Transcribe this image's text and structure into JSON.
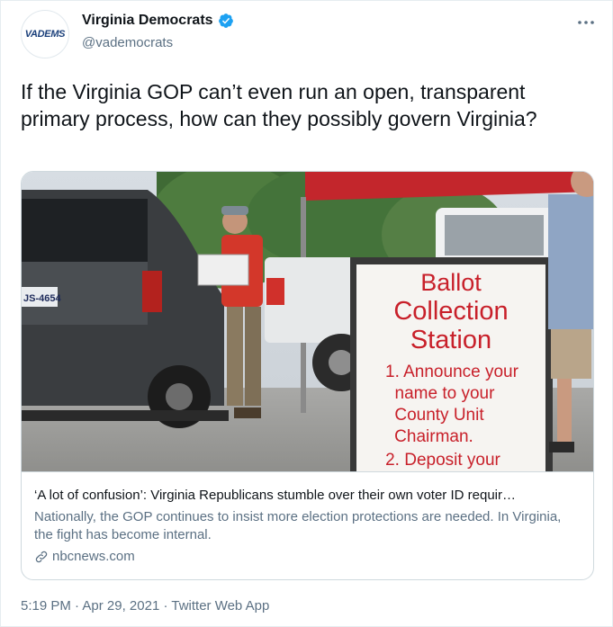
{
  "author": {
    "avatar_text_a": "VA",
    "avatar_text_b": "DEMS",
    "display_name": "Virginia Democrats",
    "handle": "@vademocrats",
    "verified": true,
    "verified_icon": "verified-badge-icon"
  },
  "menu": {
    "icon": "more-options-icon"
  },
  "tweet": {
    "text": "If the Virginia GOP can’t even run an open, transparent primary process, how can they possibly govern Virginia?"
  },
  "card": {
    "sign_lines": [
      "Ballot",
      "Collection",
      "Station",
      "1. Announce your",
      "name to your",
      "County Unit",
      "Chairman.",
      "2. Deposit your"
    ],
    "plate_text": "JS-4654",
    "title": "‘A lot of confusion’: Virginia Republicans stumble over their own voter ID requir…",
    "description": "Nationally, the GOP continues to insist more election protections are needed. In Virginia, the fight has become internal.",
    "domain": "nbcnews.com",
    "link_icon": "link-icon"
  },
  "footer": {
    "time": "5:19 PM",
    "sep1": " · ",
    "date": "Apr 29, 2021",
    "sep2": " · ",
    "source": "Twitter Web App"
  },
  "colors": {
    "text_primary": "#0f1419",
    "text_secondary": "#5b7083",
    "verified_blue": "#1da1f2",
    "sign_red": "#c8202a",
    "border": "#cfd9de"
  }
}
